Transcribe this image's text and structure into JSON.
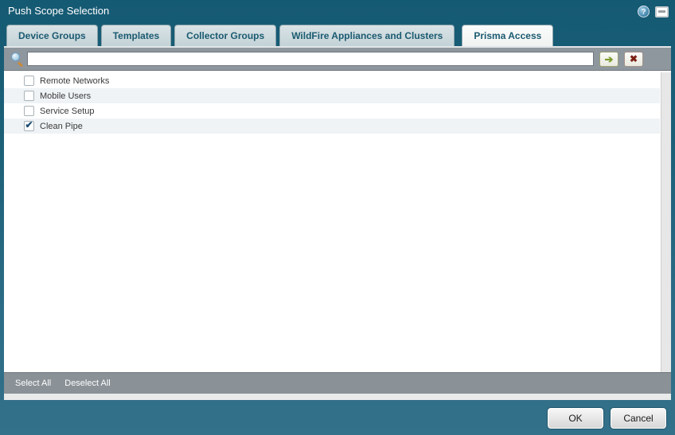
{
  "window": {
    "title": "Push Scope Selection",
    "help_glyph": "?"
  },
  "colors": {
    "titlebar_teal": "#1d6179",
    "dialog_bottom_teal": "#2f6e88",
    "tab_inactive_bg": "#cdd9dd",
    "tab_active_bg": "#f4f5f5",
    "tab_text": "#1a5a70",
    "searchbar_gray": "#8e969e",
    "row_alternate": "#eff3f6",
    "footer_bar_gray": "#8a9197",
    "checkmark_navy": "#1d4e74",
    "go_arrow_green": "#7a9c2c",
    "clear_x_red": "#7c1f12"
  },
  "tabs": [
    {
      "label": "Device Groups",
      "active": false
    },
    {
      "label": "Templates",
      "active": false
    },
    {
      "label": "Collector Groups",
      "active": false
    },
    {
      "label": "WildFire Appliances and Clusters",
      "active": false
    },
    {
      "label": "Prisma Access",
      "active": true
    }
  ],
  "search": {
    "value": "",
    "placeholder": "",
    "go_glyph": "➔",
    "clear_glyph": "✖"
  },
  "list": {
    "check_glyph": "✔",
    "items": [
      {
        "label": "Remote Networks",
        "checked": false
      },
      {
        "label": "Mobile Users",
        "checked": false
      },
      {
        "label": "Service Setup",
        "checked": false
      },
      {
        "label": "Clean Pipe",
        "checked": true
      }
    ]
  },
  "footer": {
    "select_all": "Select All",
    "deselect_all": "Deselect All"
  },
  "buttons": {
    "ok": "OK",
    "cancel": "Cancel"
  }
}
